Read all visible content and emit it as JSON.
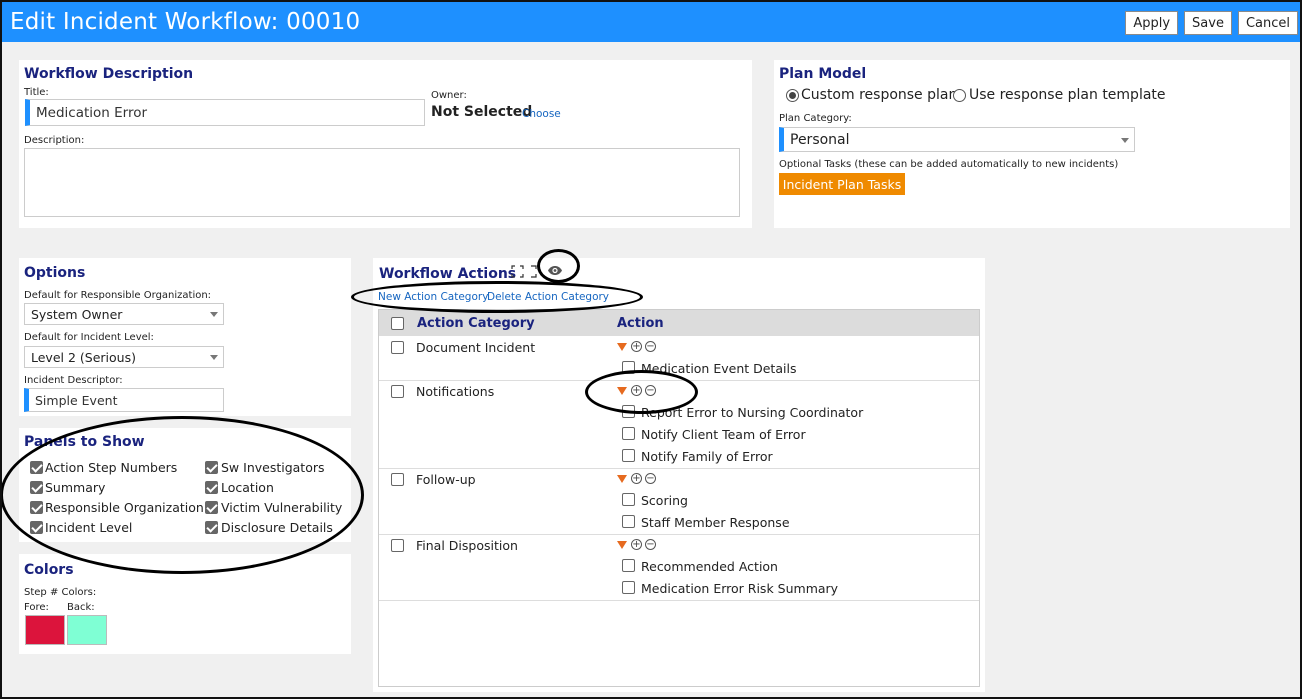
{
  "header": {
    "title": "Edit Incident Workflow: 00010",
    "apply_label": "Apply",
    "save_label": "Save",
    "cancel_label": "Cancel"
  },
  "workflow_description": {
    "heading": "Workflow Description",
    "title_label": "Title:",
    "title_value": "Medication Error",
    "owner_label": "Owner:",
    "owner_value": "Not Selected",
    "choose_link": "Choose",
    "description_label": "Description:",
    "description_value": ""
  },
  "plan_model": {
    "heading": "Plan Model",
    "radio_custom": "Custom response plan",
    "radio_template": "Use response plan template",
    "selected": "custom",
    "category_label": "Plan Category:",
    "category_value": "Personal",
    "optional_tasks_note": "Optional Tasks (these can be added automatically to new incidents)",
    "tasks_button": "Incident Plan Tasks"
  },
  "options": {
    "heading": "Options",
    "resp_org_label": "Default for Responsible Organization:",
    "resp_org_value": "System Owner",
    "level_label": "Default for Incident Level:",
    "level_value": "Level 2 (Serious)",
    "descriptor_label": "Incident Descriptor:",
    "descriptor_value": "Simple Event"
  },
  "panels_to_show": {
    "heading": "Panels to Show",
    "items": [
      {
        "label": "Action Step Numbers",
        "checked": true
      },
      {
        "label": "Sw Investigators",
        "checked": true
      },
      {
        "label": "Summary",
        "checked": true
      },
      {
        "label": "Location",
        "checked": true
      },
      {
        "label": "Responsible Organization",
        "checked": true
      },
      {
        "label": "Victim Vulnerability",
        "checked": true
      },
      {
        "label": "Incident Level",
        "checked": true
      },
      {
        "label": "Disclosure Details",
        "checked": true
      }
    ]
  },
  "colors": {
    "heading": "Colors",
    "step_label": "Step # Colors:",
    "fore_label": "Fore:",
    "back_label": "Back:",
    "fore_color": "#dc143c",
    "back_color": "#7fffd4"
  },
  "workflow_actions": {
    "heading": "Workflow Actions",
    "new_category_link": "New Action Category",
    "delete_category_link": "Delete Action Category",
    "col_category": "Action Category",
    "col_action": "Action",
    "categories": [
      {
        "name": "Document Incident",
        "actions": [
          "Medication Event Details"
        ]
      },
      {
        "name": "Notifications",
        "actions": [
          "Report Error to Nursing Coordinator",
          "Notify Client Team of Error",
          "Notify Family of Error"
        ]
      },
      {
        "name": "Follow-up",
        "actions": [
          "Scoring",
          "Staff Member Response"
        ]
      },
      {
        "name": "Final Disposition",
        "actions": [
          "Recommended Action",
          "Medication Error Risk Summary"
        ]
      }
    ]
  },
  "icons": {
    "expand": "expand-icon",
    "eye": "eye-icon",
    "add": "add-circle-icon",
    "remove": "remove-circle-icon",
    "move_down": "triangle-down-icon"
  }
}
